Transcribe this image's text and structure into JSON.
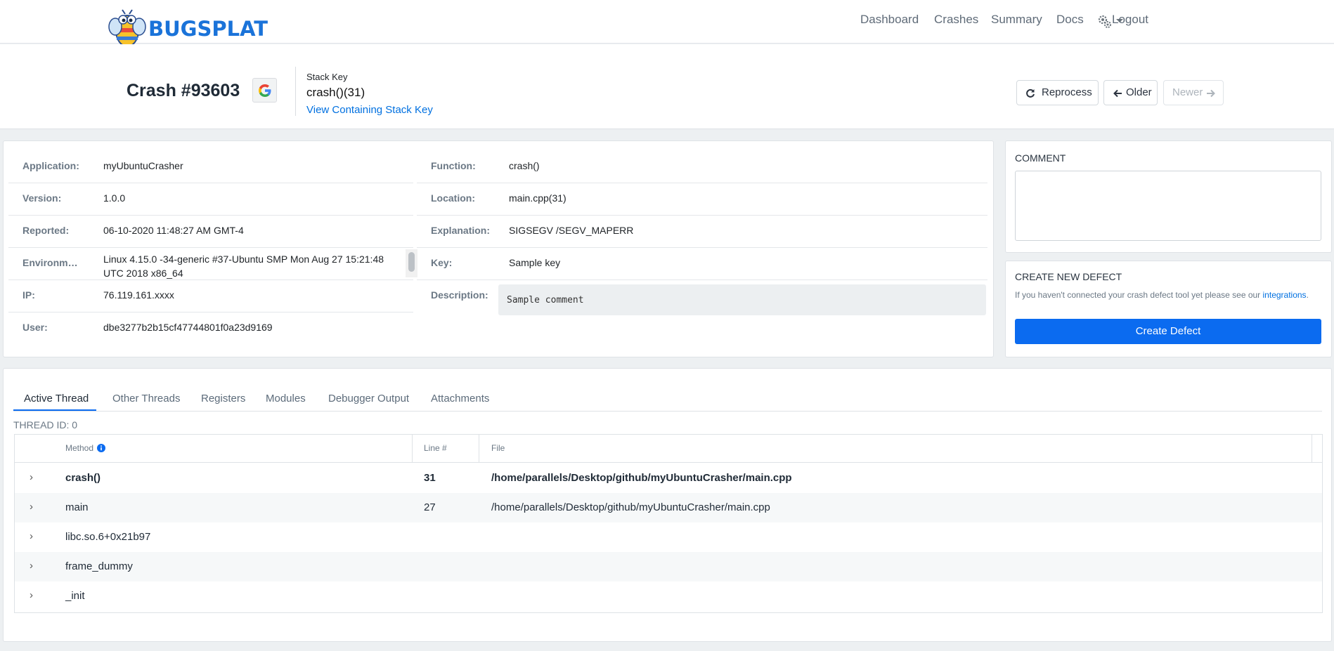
{
  "nav": {
    "brand": "BUGSPLAT",
    "links": [
      "Dashboard",
      "Crashes",
      "Summary",
      "Docs"
    ],
    "logout": "Logout"
  },
  "header": {
    "title": "Crash #93603",
    "stack_key_label": "Stack Key",
    "stack_key_value": "crash()(31)",
    "stack_key_link": "View Containing Stack Key",
    "reprocess": "Reprocess",
    "older": "Older",
    "newer": "Newer"
  },
  "details": {
    "left": [
      {
        "label": "Application:",
        "value": "myUbuntuCrasher"
      },
      {
        "label": "Version:",
        "value": "1.0.0"
      },
      {
        "label": "Reported:",
        "value": "06-10-2020 11:48:27 AM GMT-4"
      },
      {
        "label": "Environment:",
        "value": "Linux 4.15.0 -34-generic #37-Ubuntu SMP Mon Aug 27 15:21:48 UTC 2018 x86_64"
      },
      {
        "label": "IP:",
        "value": "76.119.161.xxxx"
      },
      {
        "label": "User:",
        "value": "dbe3277b2b15cf47744801f0a23d9169"
      }
    ],
    "right": [
      {
        "label": "Function:",
        "value": "crash()"
      },
      {
        "label": "Location:",
        "value": "main.cpp(31)"
      },
      {
        "label": "Explanation:",
        "value": "SIGSEGV /SEGV_MAPERR"
      },
      {
        "label": "Key:",
        "value": "Sample key"
      },
      {
        "label": "Description:",
        "value": "Sample comment"
      }
    ]
  },
  "comment": {
    "heading": "COMMENT",
    "value": ""
  },
  "defect": {
    "heading": "CREATE NEW DEFECT",
    "note": "If you haven't connected your crash defect tool yet please see our",
    "link": "integrations",
    "note_end": ".",
    "button": "Create Defect"
  },
  "tabs": [
    "Active Thread",
    "Other Threads",
    "Registers",
    "Modules",
    "Debugger Output",
    "Attachments"
  ],
  "thread_id": "THREAD ID: 0",
  "table": {
    "headers": {
      "method": "Method",
      "line": "Line #",
      "file": "File"
    },
    "rows": [
      {
        "method": "crash()",
        "line": "31",
        "file": "/home/parallels/Desktop/github/myUbuntuCrasher/main.cpp"
      },
      {
        "method": "main",
        "line": "27",
        "file": "/home/parallels/Desktop/github/myUbuntuCrasher/main.cpp"
      },
      {
        "method": "libc.so.6+0x21b97",
        "line": "",
        "file": ""
      },
      {
        "method": "frame_dummy",
        "line": "",
        "file": ""
      },
      {
        "method": "_init",
        "line": "",
        "file": ""
      }
    ]
  },
  "colors": {
    "accent": "#0b6bf0",
    "brand": "#1a73d9"
  }
}
